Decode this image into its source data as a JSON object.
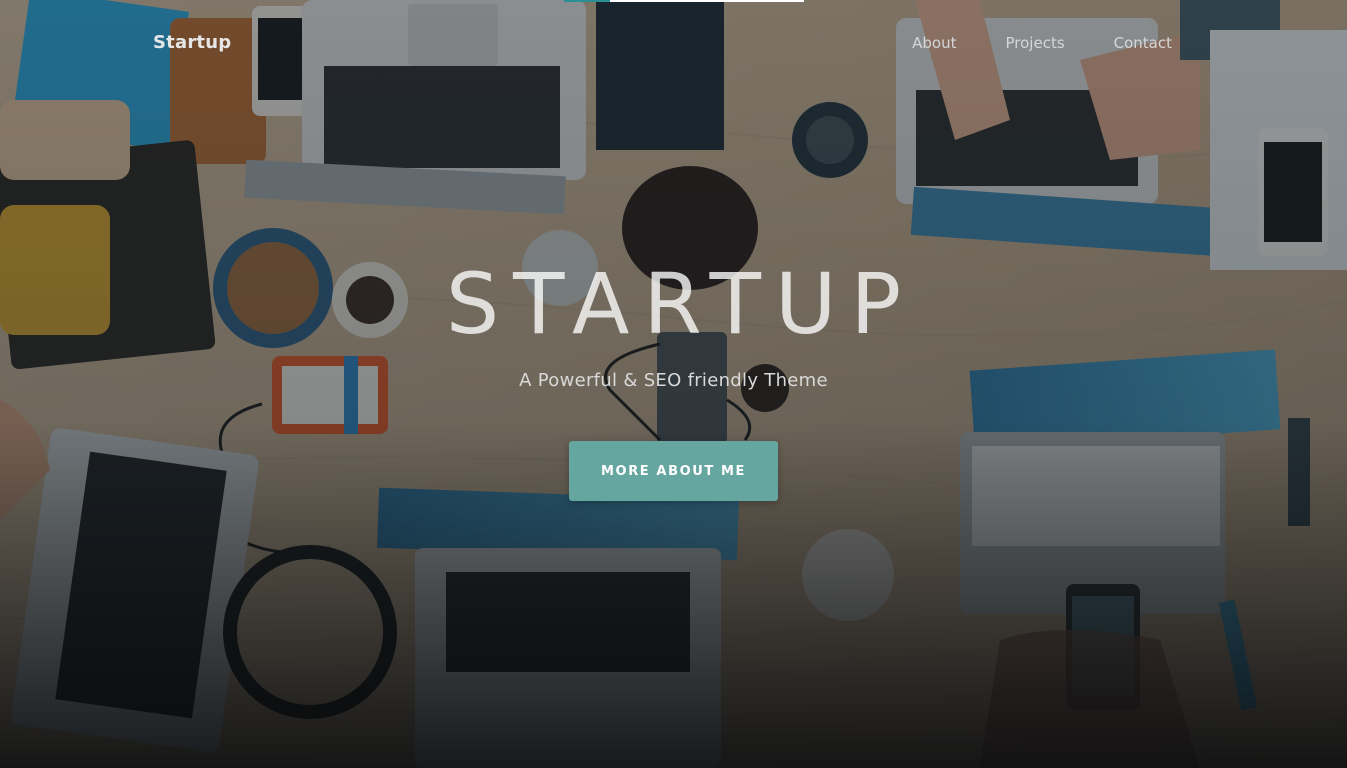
{
  "navbar": {
    "brand": "Startup",
    "links": [
      {
        "label": "About"
      },
      {
        "label": "Projects"
      },
      {
        "label": "Contact"
      }
    ]
  },
  "hero": {
    "title": "STARTUP",
    "subtitle": "A Powerful & SEO friendly Theme",
    "cta_label": "MORE ABOUT ME",
    "background": "desk-with-laptops-photo"
  },
  "colors": {
    "accent": "#66a6a0",
    "overlay": "#141c20",
    "text": "#e6e6e6"
  }
}
